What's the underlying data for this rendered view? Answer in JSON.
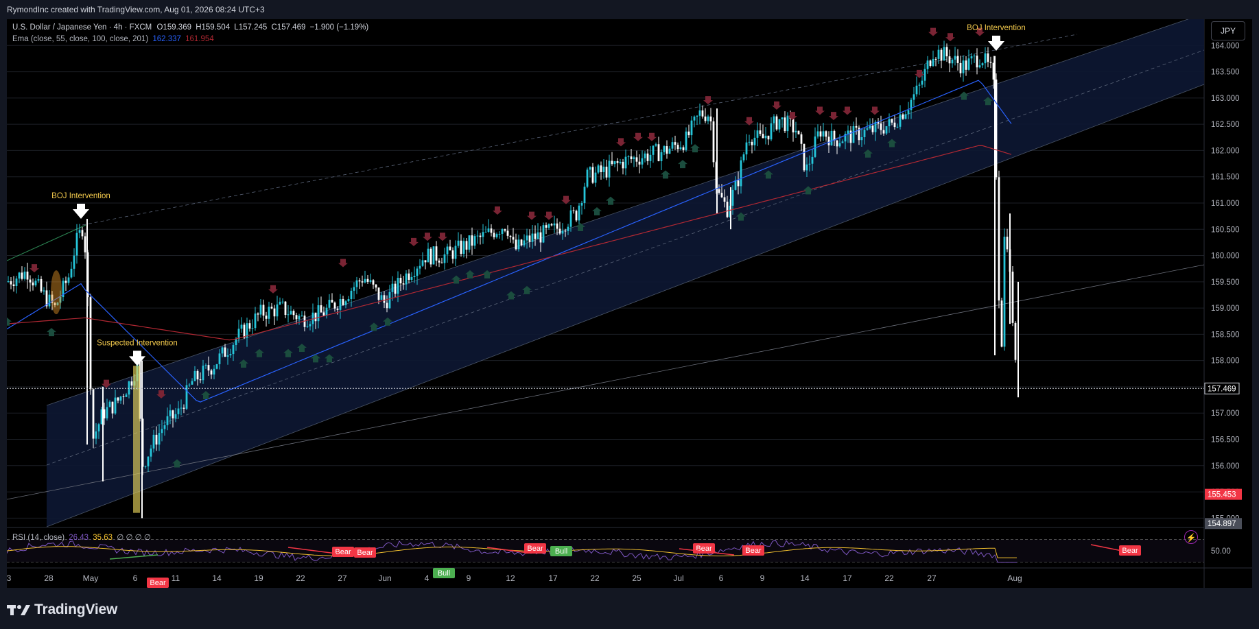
{
  "header": {
    "attribution": "RymondInc created with TradingView.com, Aug 01, 2026 08:24 UTC+3"
  },
  "legend": {
    "symbol": "U.S. Dollar / Japanese Yen · 4h · FXCM",
    "open_label": "O",
    "open": "159.369",
    "high_label": "H",
    "high": "159.504",
    "low_label": "L",
    "low": "157.245",
    "close_label": "C",
    "close": "157.469",
    "change": "−1.900 (−1.19%)",
    "ema_label": "Ema (close, 55, close, 100, close, 201)",
    "ema_fast": "162.337",
    "ema_slow": "161.954",
    "rsi_label": "RSI (14, close)",
    "rsi_value": "26.43",
    "rsi_ma": "35.63",
    "rsi_extra": "∅ ∅ ∅ ∅"
  },
  "currency_button": "JPY",
  "branding": {
    "logo_text": "TradingView"
  },
  "colors": {
    "background": "#000000",
    "frame": "#131722",
    "up_candle": "#26c6da",
    "down_candle": "#ffffff",
    "ema_fast": "#2962ff",
    "ema_slow": "#b22833",
    "channel_fill": "#0d1733",
    "annotation": "#f2c94c",
    "bear_label": "#f23645",
    "bull_label": "#4caf50",
    "rsi_line": "#7e57c2",
    "rsi_ma": "#f2c02f"
  },
  "icons": [
    "tradingview-logo-icon",
    "lightning-icon",
    "white-down-arrow-icon",
    "signal-up-arrow-icon",
    "signal-down-arrow-icon"
  ],
  "chart_data": [
    {
      "type": "candlestick",
      "title": "U.S. Dollar / Japanese Yen · 4h · FXCM",
      "ylim": [
        154.9,
        164.5
      ],
      "x_tick_labels": [
        "3",
        "28",
        "May",
        "6",
        "11",
        "14",
        "19",
        "22",
        "27",
        "Jun",
        "4",
        "9",
        "12",
        "17",
        "22",
        "25",
        "Jul",
        "6",
        "9",
        "14",
        "17",
        "22",
        "27",
        "Aug"
      ],
      "y_tick_labels": [
        "155.000",
        "155.500",
        "156.000",
        "156.500",
        "157.000",
        "157.500",
        "158.000",
        "158.500",
        "159.000",
        "159.500",
        "160.000",
        "160.500",
        "161.000",
        "161.500",
        "162.000",
        "162.500",
        "163.000",
        "163.500",
        "164.000"
      ],
      "current_price": "157.469",
      "marker_prices": [
        "155.453",
        "154.897"
      ],
      "series": [
        {
          "name": "USD/JPY close (approx.)",
          "points": [
            [
              "3",
              159.5
            ],
            [
              "28",
              159.2
            ],
            [
              "28",
              159.6
            ],
            [
              "May",
              160.6
            ],
            [
              "May",
              156.4
            ],
            [
              "May",
              157.0
            ],
            [
              "6",
              157.8
            ],
            [
              "6",
              155.9
            ],
            [
              "11",
              156.8
            ],
            [
              "11",
              157.4
            ],
            [
              "14",
              158.0
            ],
            [
              "14",
              158.5
            ],
            [
              "19",
              159.0
            ],
            [
              "22",
              158.9
            ],
            [
              "22",
              159.1
            ],
            [
              "27",
              159.6
            ],
            [
              "Jun",
              159.1
            ],
            [
              "Jun",
              159.5
            ],
            [
              "4",
              160.2
            ],
            [
              "9",
              160.3
            ],
            [
              "9",
              160.5
            ],
            [
              "12",
              160.2
            ],
            [
              "12",
              160.2
            ],
            [
              "17",
              160.5
            ],
            [
              "17",
              161.2
            ],
            [
              "22",
              161.6
            ],
            [
              "25",
              161.9
            ],
            [
              "25",
              162.0
            ],
            [
              "Jul",
              162.8
            ],
            [
              "Jul",
              161.2
            ],
            [
              "6",
              161.3
            ],
            [
              "6",
              162.3
            ],
            [
              "9",
              162.6
            ],
            [
              "14",
              162.1
            ],
            [
              "14",
              162.4
            ],
            [
              "17",
              162.3
            ],
            [
              "22",
              162.6
            ],
            [
              "22",
              163.2
            ],
            [
              "27",
              164.0
            ],
            [
              "27",
              163.8
            ],
            [
              "27",
              163.5
            ],
            [
              "Aug",
              163.1
            ],
            [
              "Aug",
              158.2
            ],
            [
              "Aug",
              160.7
            ],
            [
              "Aug",
              157.47
            ]
          ]
        },
        {
          "name": "Ema 55",
          "last_value": 162.337
        },
        {
          "name": "Ema 201",
          "last_value": 161.954
        }
      ],
      "annotations": [
        {
          "text": "BOJ Intervention",
          "x": "May",
          "y": 160.7
        },
        {
          "text": "Suspected Intervention",
          "x": "6",
          "y": 157.9
        },
        {
          "text": "BOJ Intervention",
          "x": "Aug",
          "y": 163.9
        }
      ]
    },
    {
      "type": "line",
      "title": "RSI (14, close)",
      "y_tick_labels": [
        "50.00"
      ],
      "divergence_labels": [
        "Bear",
        "Bear",
        "Bull",
        "Bear",
        "Bear",
        "Bull",
        "Bear",
        "Bear",
        "Bear",
        "Bear"
      ],
      "series": [
        {
          "name": "RSI",
          "last_value": 26.43
        },
        {
          "name": "RSI-based MA",
          "last_value": 35.63
        }
      ]
    }
  ]
}
